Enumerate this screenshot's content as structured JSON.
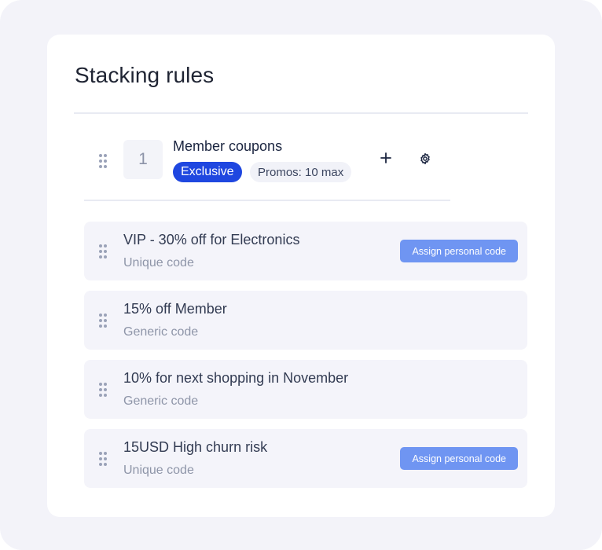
{
  "panel": {
    "title": "Stacking rules"
  },
  "group": {
    "number": "1",
    "name": "Member coupons",
    "badge_exclusive": "Exclusive",
    "badge_promos": "Promos: 10 max",
    "add_icon": "plus-icon",
    "settings_icon": "gear-icon"
  },
  "rules": [
    {
      "name": "VIP - 30% off for Electronics",
      "type": "Unique code",
      "action": "Assign personal code"
    },
    {
      "name": "15% off Member",
      "type": "Generic code"
    },
    {
      "name": "10% for next shopping in November",
      "type": "Generic code"
    },
    {
      "name": "15USD High churn risk",
      "type": "Unique code",
      "action": "Assign personal code"
    }
  ],
  "colors": {
    "accent": "#1f47e0",
    "button": "#6f95f2",
    "row_bg": "#f4f4fa"
  }
}
